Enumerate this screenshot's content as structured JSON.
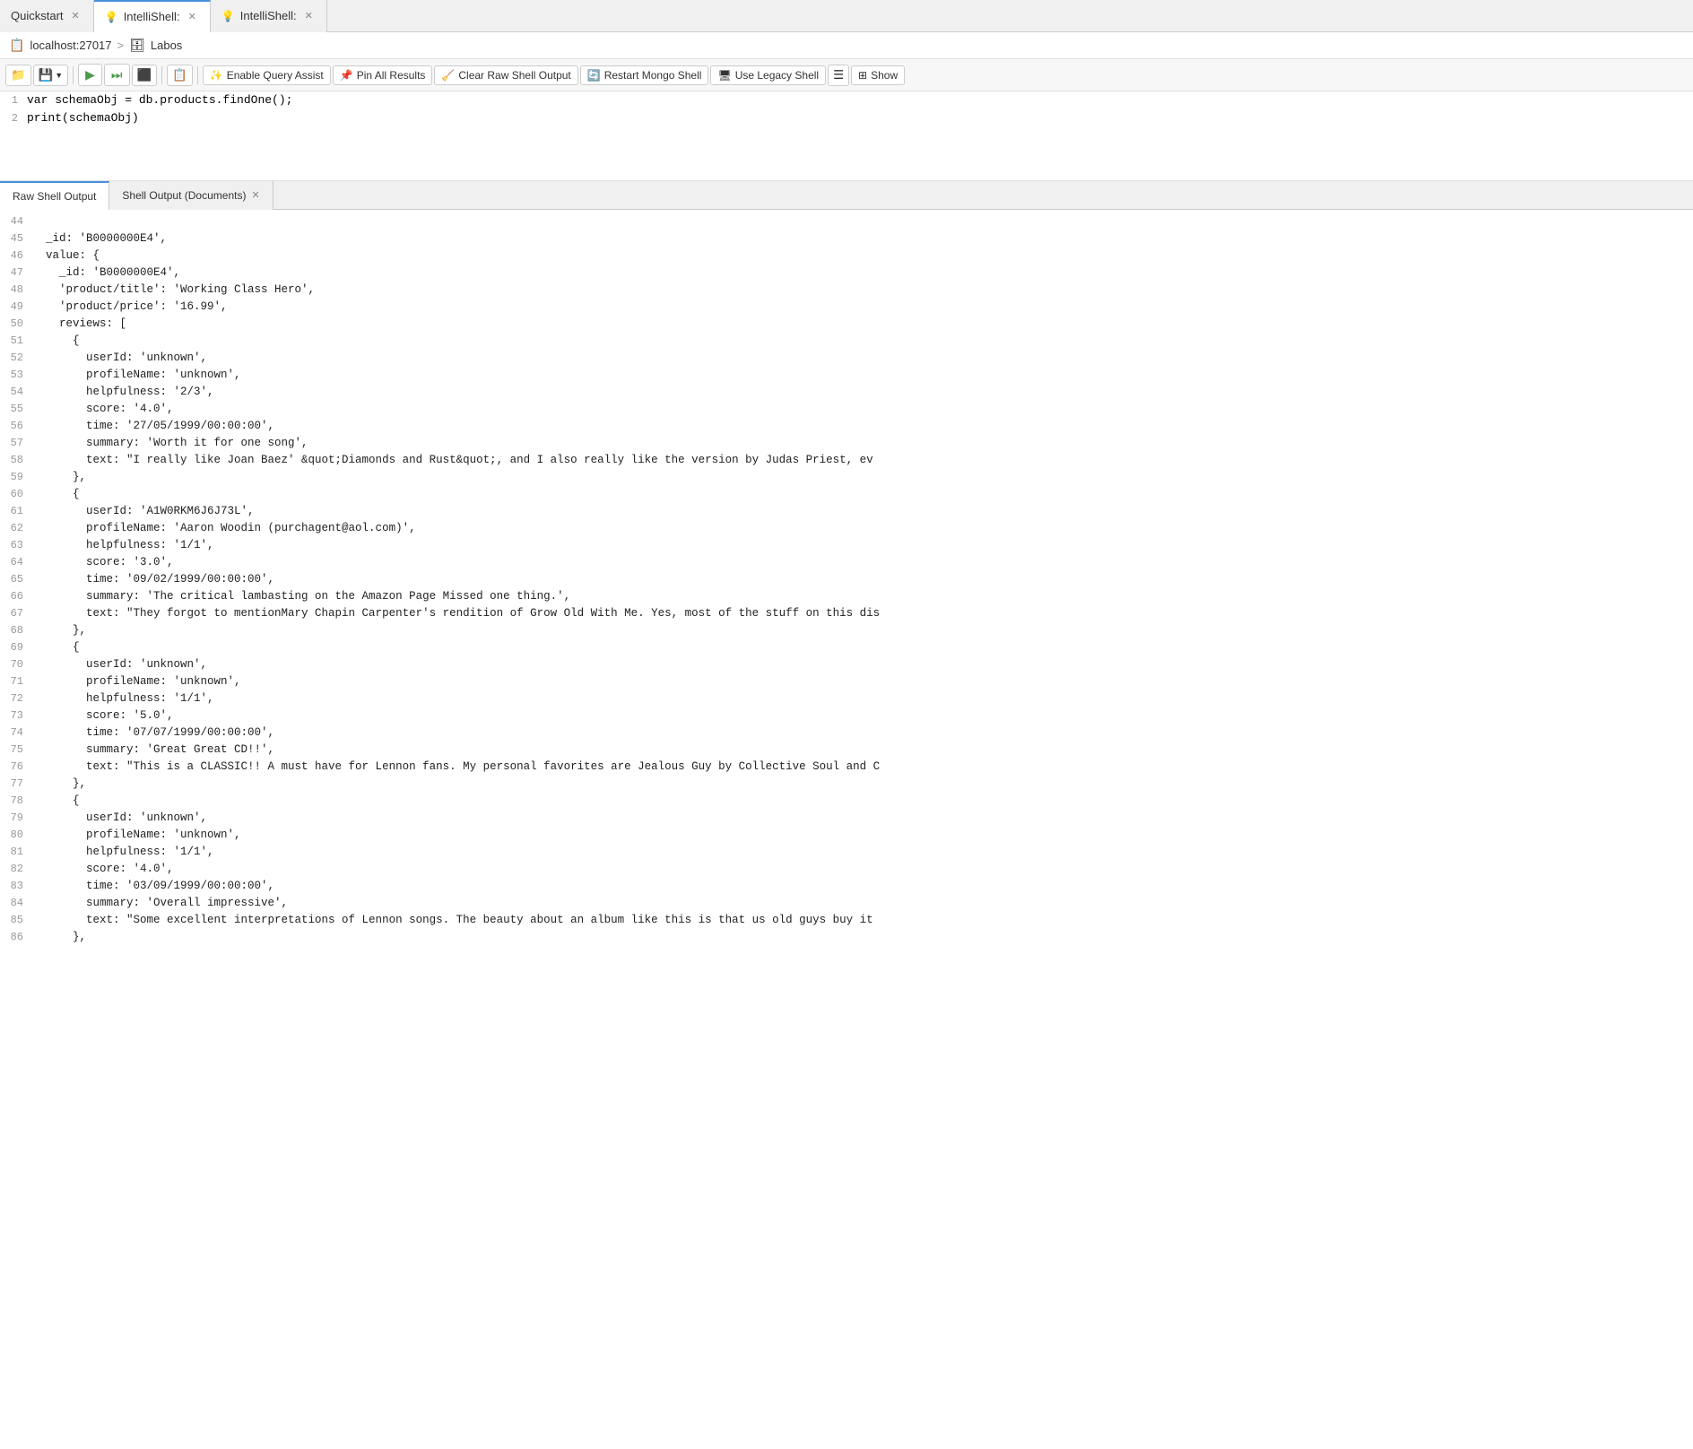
{
  "tabs": [
    {
      "id": "quickstart",
      "label": "Quickstart",
      "closable": true,
      "active": false
    },
    {
      "id": "intellishell1",
      "label": "IntelliShell:",
      "closable": true,
      "active": true
    },
    {
      "id": "intellishell2",
      "label": "IntelliShell:",
      "closable": true,
      "active": false
    }
  ],
  "breadcrumb": {
    "host": "localhost:27017",
    "separator": ">",
    "db_icon": "🗄",
    "database": "Labos"
  },
  "toolbar": {
    "folder_icon": "📁",
    "save_label": "💾",
    "play_label": "▶",
    "play_all_label": "⏭",
    "stop_label": "⬛",
    "script_label": "📋",
    "query_assist_icon": "✨",
    "query_assist_label": "Enable Query Assist",
    "pin_icon": "📌",
    "pin_label": "Pin All Results",
    "clear_icon": "🧹",
    "clear_label": "Clear Raw Shell Output",
    "restart_icon": "🔄",
    "restart_label": "Restart Mongo Shell",
    "legacy_icon": "🖥",
    "legacy_label": "Use Legacy Shell",
    "menu_icon": "☰",
    "expand_icon": "⊞",
    "show_label": "Show"
  },
  "editor": {
    "lines": [
      {
        "num": "1",
        "content": "var schemaObj = db.products.findOne();"
      },
      {
        "num": "2",
        "content": "print(schemaObj)"
      }
    ]
  },
  "output_tabs": [
    {
      "id": "raw",
      "label": "Raw Shell Output",
      "active": true,
      "closable": false
    },
    {
      "id": "docs",
      "label": "Shell Output (Documents)",
      "active": false,
      "closable": true
    }
  ],
  "output_lines": [
    {
      "num": "44",
      "content": ""
    },
    {
      "num": "45",
      "content": "  _id: 'B0000000E4',"
    },
    {
      "num": "46",
      "content": "  value: {"
    },
    {
      "num": "47",
      "content": "    _id: 'B0000000E4',"
    },
    {
      "num": "48",
      "content": "    'product/title': 'Working Class Hero',"
    },
    {
      "num": "49",
      "content": "    'product/price': '16.99',"
    },
    {
      "num": "50",
      "content": "    reviews: ["
    },
    {
      "num": "51",
      "content": "      {"
    },
    {
      "num": "52",
      "content": "        userId: 'unknown',"
    },
    {
      "num": "53",
      "content": "        profileName: 'unknown',"
    },
    {
      "num": "54",
      "content": "        helpfulness: '2/3',"
    },
    {
      "num": "55",
      "content": "        score: '4.0',"
    },
    {
      "num": "56",
      "content": "        time: '27/05/1999/00:00:00',"
    },
    {
      "num": "57",
      "content": "        summary: 'Worth it for one song',"
    },
    {
      "num": "58",
      "content": "        text: \"I really like Joan Baez' &quot;Diamonds and Rust&quot;, and I also really like the version by Judas Priest, ev"
    },
    {
      "num": "59",
      "content": "      },"
    },
    {
      "num": "60",
      "content": "      {"
    },
    {
      "num": "61",
      "content": "        userId: 'A1W0RKM6J6J73L',"
    },
    {
      "num": "62",
      "content": "        profileName: 'Aaron Woodin (purchagent@aol.com)',"
    },
    {
      "num": "63",
      "content": "        helpfulness: '1/1',"
    },
    {
      "num": "64",
      "content": "        score: '3.0',"
    },
    {
      "num": "65",
      "content": "        time: '09/02/1999/00:00:00',"
    },
    {
      "num": "66",
      "content": "        summary: 'The critical lambasting on the Amazon Page Missed one thing.',"
    },
    {
      "num": "67",
      "content": "        text: \"They forgot to mentionMary Chapin Carpenter's rendition of Grow Old With Me. Yes, most of the stuff on this dis"
    },
    {
      "num": "68",
      "content": "      },"
    },
    {
      "num": "69",
      "content": "      {"
    },
    {
      "num": "70",
      "content": "        userId: 'unknown',"
    },
    {
      "num": "71",
      "content": "        profileName: 'unknown',"
    },
    {
      "num": "72",
      "content": "        helpfulness: '1/1',"
    },
    {
      "num": "73",
      "content": "        score: '5.0',"
    },
    {
      "num": "74",
      "content": "        time: '07/07/1999/00:00:00',"
    },
    {
      "num": "75",
      "content": "        summary: 'Great Great CD!!',"
    },
    {
      "num": "76",
      "content": "        text: \"This is a CLASSIC!! A must have for Lennon fans. My personal favorites are Jealous Guy by Collective Soul and C"
    },
    {
      "num": "77",
      "content": "      },"
    },
    {
      "num": "78",
      "content": "      {"
    },
    {
      "num": "79",
      "content": "        userId: 'unknown',"
    },
    {
      "num": "80",
      "content": "        profileName: 'unknown',"
    },
    {
      "num": "81",
      "content": "        helpfulness: '1/1',"
    },
    {
      "num": "82",
      "content": "        score: '4.0',"
    },
    {
      "num": "83",
      "content": "        time: '03/09/1999/00:00:00',"
    },
    {
      "num": "84",
      "content": "        summary: 'Overall impressive',"
    },
    {
      "num": "85",
      "content": "        text: \"Some excellent interpretations of Lennon songs. The beauty about an album like this is that us old guys buy it"
    },
    {
      "num": "86",
      "content": "      },"
    }
  ]
}
